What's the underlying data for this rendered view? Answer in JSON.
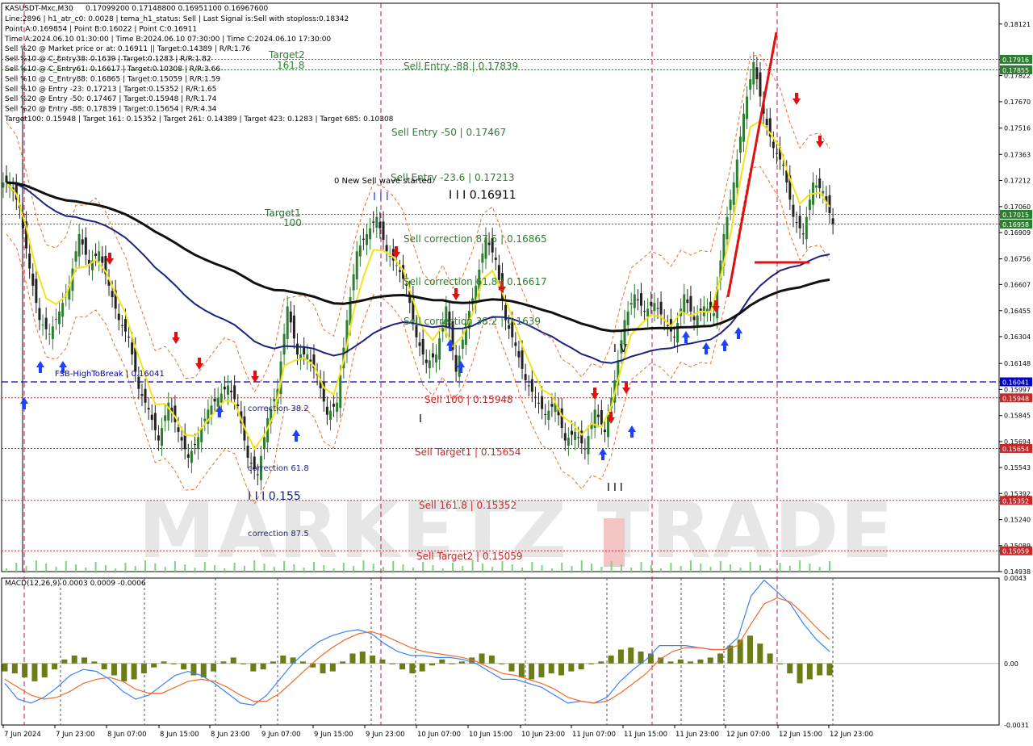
{
  "chart_data": [
    {
      "type": "line",
      "symbol": "KASUSDT-Mxc,M30",
      "ohlc": "0.17099200 0.17148800 0.16951100 0.16967600",
      "info_lines": [
        "Line:2896  |  h1_atr_c0: 0.0028  |  tema_h1_status: Sell  |  Last Signal is:Sell with stoploss:0.18342",
        "Point A:0.169854  |  Point B:0.16022  |  Point C:0.16911",
        "Time A:2024.06.10 01:30:00  |  Time B:2024.06.10 07:30:00  |  Time C:2024.06.10 17:30:00",
        "Sell %20 @ Market price or at: 0.16911  ||  Target:0.14389  |  R/R:1.76",
        "Sell %10 @ C_Entry38: 0.1639  |  Target:0.1283  |  R/R:1.82",
        "Sell %10 @ C_Entry61: 0.16617  |  Target:0.10308  |  R/R:3.66",
        "Sell %10 @ C_Entry88: 0.16865  |  Target:0.15059  |  R/R:1.59",
        "Sell %10 @ Entry -23: 0.17213  |  Target:0.15352  |  R/R:1.65",
        "Sell %20 @ Entry -50: 0.17467  |  Target:0.15948  |  R/R:1.74",
        "Sell %20 @ Entry -88: 0.17839  |  Target:0.15654  |  R/R:4.34",
        "Target100: 0.15948  |  Target 161: 0.15352  |  Target 261: 0.14389  |  Target 423: 0.1283  |  Target 685: 0.10308"
      ],
      "y_range": [
        0.14938,
        0.18242
      ],
      "y_ticks": [
        "0.18121",
        "0.17916",
        "0.17855",
        "0.17822",
        "0.17670",
        "0.17516",
        "0.17363",
        "0.17212",
        "0.17060",
        "0.17015",
        "0.16958",
        "0.16909",
        "0.16756",
        "0.16607",
        "0.16455",
        "0.16304",
        "0.16148",
        "0.16041",
        "0.15997",
        "0.15948",
        "0.15845",
        "0.15694",
        "0.15654",
        "0.15543",
        "0.15392",
        "0.15352",
        "0.15240",
        "0.15089",
        "0.15059",
        "0.14938"
      ],
      "x_labels": [
        "7 Jun 2024",
        "7 Jun 23:00",
        "8 Jun 07:00",
        "8 Jun 15:00",
        "8 Jun 23:00",
        "9 Jun 07:00",
        "9 Jun 15:00",
        "9 Jun 23:00",
        "10 Jun 07:00",
        "10 Jun 15:00",
        "10 Jun 23:00",
        "11 Jun 07:00",
        "11 Jun 15:00",
        "11 Jun 23:00",
        "12 Jun 07:00",
        "12 Jun 15:00",
        "12 Jun 23:00"
      ],
      "current_price": 0.16958,
      "levels": [
        {
          "label": "Sell Entry -88 | 0.17839",
          "value": 0.17839,
          "color": "#2e7d32"
        },
        {
          "label": "Sell Entry -50 | 0.17467",
          "value": 0.17467,
          "color": "#2e7d32"
        },
        {
          "label": "Sell Entry -23.6 | 0.17213",
          "value": 0.17213,
          "color": "#2e7d32"
        },
        {
          "label": "I I I 0.16911",
          "value": 0.16911,
          "color": "#000000"
        },
        {
          "label": "Sell correction 87.5 | 0.16865",
          "value": 0.16865,
          "color": "#2e7d32"
        },
        {
          "label": "Sell correction 61.8 | 0.16617",
          "value": 0.16617,
          "color": "#2e7d32"
        },
        {
          "label": "Sell correction 38.2 | 0.1639",
          "value": 0.1639,
          "color": "#2e7d32"
        },
        {
          "label": "FSB-HighToBreak | 0.16041",
          "value": 0.16041,
          "color": "#0000cc"
        },
        {
          "label": "Sell 100 | 0.15948",
          "value": 0.15948,
          "color": "#c62828"
        },
        {
          "label": "Sell Target1 | 0.15654",
          "value": 0.15654,
          "color": "#c62828"
        },
        {
          "label": "Sell 161.8 | 0.15352",
          "value": 0.15352,
          "color": "#c62828"
        },
        {
          "label": "Sell Target2 | 0.15059",
          "value": 0.15059,
          "color": "#c62828"
        }
      ],
      "annotations": [
        {
          "text": "Target2",
          "sub": "161.8"
        },
        {
          "text": "Target1",
          "sub": "100"
        },
        {
          "text": "0 New Sell wave started"
        },
        {
          "text": "correction 38.2"
        },
        {
          "text": "correction 61.8"
        },
        {
          "text": "correction 87.5"
        },
        {
          "text": "I I I 0.155"
        }
      ],
      "series_close": [
        0.172,
        0.1705,
        0.167,
        0.164,
        0.1632,
        0.1645,
        0.166,
        0.169,
        0.1672,
        0.168,
        0.166,
        0.164,
        0.163,
        0.16,
        0.1588,
        0.157,
        0.1592,
        0.1575,
        0.156,
        0.1572,
        0.1588,
        0.1595,
        0.1602,
        0.159,
        0.156,
        0.155,
        0.1583,
        0.16,
        0.1648,
        0.162,
        0.162,
        0.1608,
        0.1585,
        0.1592,
        0.164,
        0.168,
        0.169,
        0.17,
        0.168,
        0.1672,
        0.166,
        0.163,
        0.1615,
        0.162,
        0.1648,
        0.161,
        0.1638,
        0.166,
        0.1688,
        0.1675,
        0.164,
        0.1625,
        0.1605,
        0.1595,
        0.1585,
        0.1592,
        0.157,
        0.1575,
        0.1565,
        0.1588,
        0.1575,
        0.1605,
        0.164,
        0.1655,
        0.1645,
        0.165,
        0.164,
        0.163,
        0.1655,
        0.164,
        0.1648,
        0.1644,
        0.169,
        0.172,
        0.176,
        0.179,
        0.176,
        0.174,
        0.173,
        0.17,
        0.169,
        0.172,
        0.1715,
        0.16958
      ],
      "macd": {
        "label": "MACD(12,26,9) 0.0003 0.0009 -0.0006",
        "y_range": [
          -0.0031,
          0.0043
        ],
        "y_ticks": [
          "0.0043",
          "0.00",
          "-0.0031"
        ],
        "hist": [
          -0.0004,
          -0.0005,
          -0.0007,
          -0.0009,
          -0.0007,
          -0.0003,
          0.0002,
          0.0004,
          0.0003,
          0.0001,
          -0.0003,
          -0.0006,
          -0.0009,
          -0.0008,
          -0.0005,
          -0.0002,
          0.0001,
          0.0,
          -0.0003,
          -0.0006,
          -0.0007,
          -0.0004,
          0.0001,
          0.0003,
          0.0,
          -0.0004,
          -0.0003,
          0.0001,
          0.0004,
          0.0003,
          0.0001,
          -0.0002,
          -0.0005,
          -0.0004,
          0.0001,
          0.0005,
          0.0006,
          0.0004,
          0.0002,
          0.0,
          -0.0003,
          -0.0005,
          -0.0004,
          -0.0001,
          0.0002,
          0.0,
          0.0001,
          0.0003,
          0.0005,
          0.0004,
          0.0,
          -0.0004,
          -0.0007,
          -0.0008,
          -0.0007,
          -0.0005,
          -0.0006,
          -0.0004,
          -0.0003,
          0.0,
          0.0001,
          0.0004,
          0.0007,
          0.0008,
          0.0006,
          0.0005,
          0.0003,
          0.0001,
          0.0002,
          0.0001,
          0.0002,
          0.0003,
          0.0005,
          0.0009,
          0.0012,
          0.0014,
          0.001,
          0.0005,
          0.0,
          -0.0005,
          -0.001,
          -0.0008,
          -0.0006,
          -0.0006
        ],
        "macd_line": [
          -0.001,
          -0.0018,
          -0.002,
          -0.0017,
          -0.0012,
          -0.0006,
          -0.0003,
          -0.0004,
          -0.0008,
          -0.0014,
          -0.0018,
          -0.0016,
          -0.0011,
          -0.0006,
          -0.0004,
          -0.0006,
          -0.001,
          -0.0015,
          -0.002,
          -0.0021,
          -0.0016,
          -0.0008,
          0.0,
          0.0006,
          0.0011,
          0.0014,
          0.0016,
          0.0017,
          0.0015,
          0.001,
          0.0006,
          0.0004,
          0.0004,
          0.0003,
          0.0003,
          0.0002,
          0.0,
          -0.0004,
          -0.0008,
          -0.0008,
          -0.001,
          -0.0012,
          -0.0016,
          -0.002,
          -0.0019,
          -0.002,
          -0.0017,
          -0.0009,
          -0.0003,
          0.0002,
          0.0009,
          0.0009,
          0.0009,
          0.0008,
          0.0007,
          0.0007,
          0.0013,
          0.0034,
          0.0042,
          0.0036,
          0.003,
          0.002,
          0.0012,
          0.0006
        ],
        "signal_line": [
          -0.0008,
          -0.0012,
          -0.0016,
          -0.0018,
          -0.0017,
          -0.0014,
          -0.001,
          -0.0008,
          -0.0007,
          -0.0009,
          -0.0013,
          -0.0015,
          -0.0015,
          -0.0012,
          -0.0009,
          -0.0008,
          -0.0009,
          -0.0012,
          -0.0016,
          -0.0019,
          -0.0019,
          -0.0015,
          -0.0009,
          -0.0003,
          0.0003,
          0.0008,
          0.0012,
          0.0015,
          0.0016,
          0.0014,
          0.0011,
          0.0008,
          0.0006,
          0.0005,
          0.0004,
          0.0003,
          0.0001,
          -0.0002,
          -0.0005,
          -0.0006,
          -0.0008,
          -0.001,
          -0.0013,
          -0.0017,
          -0.0019,
          -0.002,
          -0.0019,
          -0.0015,
          -0.001,
          -0.0005,
          0.0002,
          0.0006,
          0.0008,
          0.0008,
          0.0007,
          0.0007,
          0.0009,
          0.002,
          0.003,
          0.0033,
          0.0031,
          0.0025,
          0.0018,
          0.0012
        ]
      },
      "price_tags": [
        {
          "value": 0.17916,
          "text": "0.17916",
          "color": "#2e7d32"
        },
        {
          "value": 0.17855,
          "text": "0.17855",
          "color": "#2e7d32"
        },
        {
          "value": 0.17015,
          "text": "0.17015",
          "color": "#2e7d32"
        },
        {
          "value": 0.16958,
          "text": "0.16958",
          "color": "#2e7d32"
        },
        {
          "value": 0.16041,
          "text": "0.16041",
          "color": "#0000cc"
        },
        {
          "value": 0.15948,
          "text": "0.15948",
          "color": "#c62828"
        },
        {
          "value": 0.15654,
          "text": "0.15654",
          "color": "#c62828"
        },
        {
          "value": 0.15352,
          "text": "0.15352",
          "color": "#c62828"
        },
        {
          "value": 0.15059,
          "text": "0.15059",
          "color": "#c62828"
        }
      ],
      "watermark": "MARKETZ TRADE",
      "colors": {
        "up": "#2e7d32",
        "down": "#222222",
        "ema_black": "#111111",
        "ema_navy": "#1a237e",
        "yellow": "#f4e21b",
        "orange": "#ef6c2a",
        "buy_arrow": "#1e40ff",
        "sell_arrow": "#e01010",
        "red_line": "#e01010",
        "macd_line": "#3b82f6",
        "signal_line": "#ef6c2a",
        "hist": "#6b7d17",
        "grid_magenta": "#c2185b"
      }
    }
  ]
}
